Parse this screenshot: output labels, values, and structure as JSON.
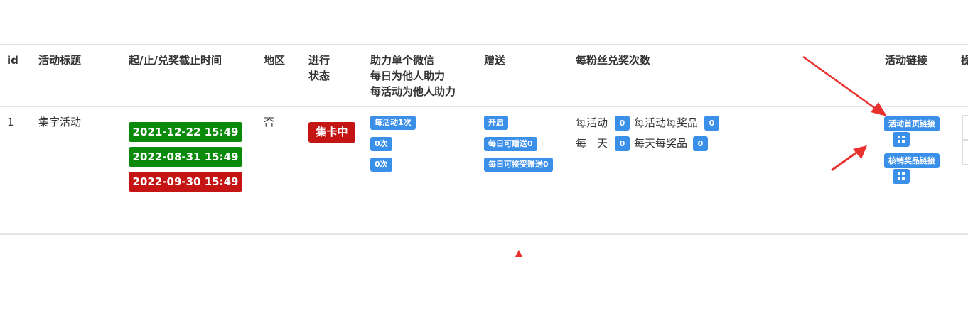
{
  "table": {
    "headers": {
      "id": "id",
      "title": "活动标题",
      "time": "起/止/兑奖截止时间",
      "region": "地区",
      "status_l1": "进行",
      "status_l2": "状态",
      "assist_l1": "助力单个微信",
      "assist_l2": "每日为他人助力",
      "assist_l3": "每活动为他人助力",
      "gift": "赠送",
      "redeem": "每粉丝兑奖次数",
      "link": "活动链接",
      "op_partial": "操"
    },
    "row": {
      "id": "1",
      "title": "集字活动",
      "start": "2021-12-22 15:49",
      "end": "2022-08-31 15:49",
      "deadline": "2022-09-30 15:49",
      "region": "否",
      "status": "集卡中",
      "assist": [
        "每活动1次",
        "0次",
        "0次"
      ],
      "gift": [
        "开启",
        "每日可赠送0",
        "每日可接受赠送0"
      ],
      "redeem": {
        "per_activity_label": "每活动",
        "per_activity_value": "0",
        "per_activity_prize_label": "每活动每奖品",
        "per_activity_prize_value": "0",
        "per_day_label": "每　天",
        "per_day_value": "0",
        "per_day_prize_label": "每天每奖品",
        "per_day_prize_value": "0"
      },
      "links": {
        "home_link": "活动首页链接",
        "verify_link": "核销奖品链接"
      }
    }
  },
  "colors": {
    "start_date": "#0a8a0a",
    "end_date": "#0a8a0a",
    "deadline": "#c41414",
    "status": "#c41414",
    "badge": "#3a8fe8",
    "arrow": "#e8312f"
  }
}
